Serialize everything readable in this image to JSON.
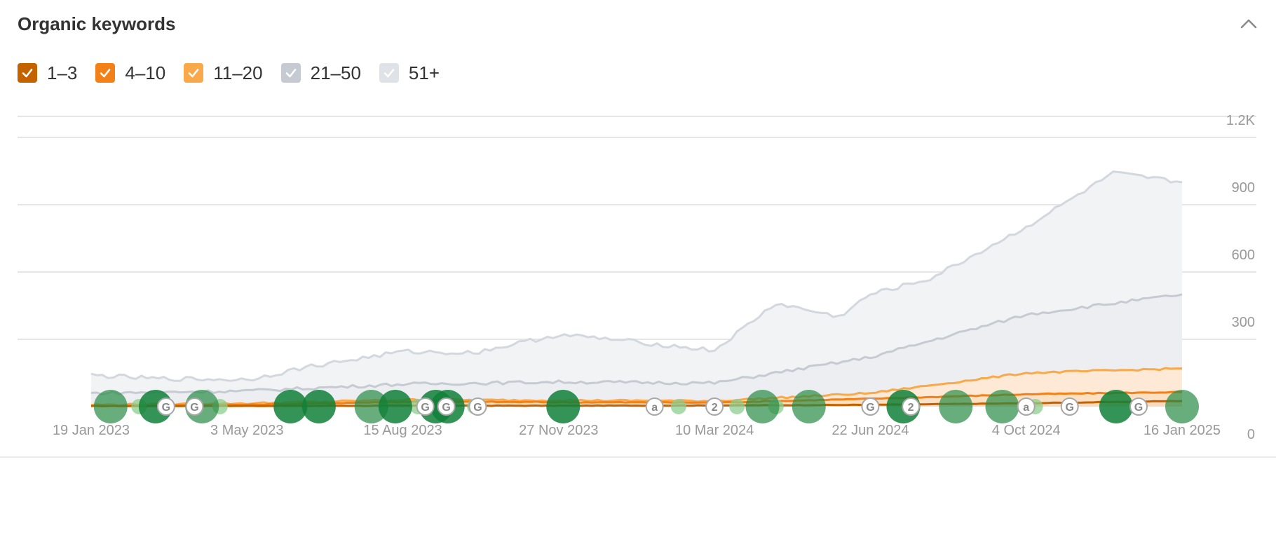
{
  "panel": {
    "title": "Organic keywords"
  },
  "legend": [
    {
      "label": "1–3",
      "color": "#c46200",
      "checked": true
    },
    {
      "label": "4–10",
      "color": "#f38118",
      "checked": true
    },
    {
      "label": "11–20",
      "color": "#f9a94a",
      "checked": true
    },
    {
      "label": "21–50",
      "color": "#c6cbd3",
      "checked": true
    },
    {
      "label": "51+",
      "color": "#dfe2e7",
      "checked": true
    }
  ],
  "chart_data": {
    "type": "area",
    "xlabel": "",
    "ylabel": "",
    "x_ticks": [
      "19 Jan 2023",
      "3 May 2023",
      "15 Aug 2023",
      "27 Nov 2023",
      "10 Mar 2024",
      "22 Jun 2024",
      "4 Oct 2024",
      "16 Jan 2025"
    ],
    "y_ticks": [
      "0",
      "300",
      "600",
      "900",
      "1.2K"
    ],
    "ylim": [
      0,
      1200
    ],
    "grid": true,
    "series": [
      {
        "name": "1–3",
        "color": "#c46200",
        "x": [
          "19 Jan 2023",
          "3 May 2023",
          "15 Aug 2023",
          "27 Nov 2023",
          "10 Mar 2024",
          "22 Jun 2024",
          "4 Oct 2024",
          "16 Jan 2025"
        ],
        "values": [
          2,
          3,
          4,
          4,
          5,
          8,
          15,
          25
        ]
      },
      {
        "name": "4–10",
        "color": "#f38118",
        "x": [
          "19 Jan 2023",
          "3 May 2023",
          "15 Aug 2023",
          "27 Nov 2023",
          "10 Mar 2024",
          "22 Jun 2024",
          "4 Oct 2024",
          "16 Jan 2025"
        ],
        "values": [
          4,
          8,
          22,
          20,
          18,
          35,
          55,
          65
        ]
      },
      {
        "name": "11–20",
        "color": "#f9a94a",
        "x": [
          "19 Jan 2023",
          "3 May 2023",
          "15 Aug 2023",
          "27 Nov 2023",
          "10 Mar 2024",
          "22 Jun 2024",
          "4 Oct 2024",
          "16 Jan 2025"
        ],
        "values": [
          8,
          14,
          30,
          28,
          25,
          60,
          150,
          170
        ]
      },
      {
        "name": "21–50",
        "color": "#c6cbd3",
        "x": [
          "19 Jan 2023",
          "3 May 2023",
          "15 Aug 2023",
          "27 Nov 2023",
          "10 Mar 2024",
          "22 Jun 2024",
          "4 Oct 2024",
          "16 Jan 2025"
        ],
        "values": [
          60,
          70,
          100,
          110,
          105,
          220,
          410,
          500
        ]
      },
      {
        "name": "51+",
        "color": "#dfe2e7",
        "x": [
          "19 Jan 2023",
          "1 Mar 2023",
          "3 May 2023",
          "15 Jun 2023",
          "15 Aug 2023",
          "1 Oct 2023",
          "27 Nov 2023",
          "1 Jan 2024",
          "10 Mar 2024",
          "20 Apr 2024",
          "1 Jun 2024",
          "22 Jun 2024",
          "1 Aug 2024",
          "4 Oct 2024",
          "1 Dec 2024",
          "16 Jan 2025"
        ],
        "values": [
          140,
          125,
          120,
          180,
          245,
          240,
          320,
          300,
          250,
          460,
          400,
          500,
          570,
          800,
          1040,
          1000
        ]
      }
    ],
    "annotations": [
      {
        "label": "G",
        "x": "10 Mar 2023"
      },
      {
        "label": "G",
        "x": "29 Mar 2023"
      },
      {
        "label": "G",
        "x": "30 Aug 2023"
      },
      {
        "label": "G",
        "x": "13 Sep 2023"
      },
      {
        "label": "G",
        "x": "4 Oct 2023"
      },
      {
        "label": "a",
        "x": "30 Jan 2024"
      },
      {
        "label": "2",
        "x": "10 Mar 2024"
      },
      {
        "label": "G",
        "x": "22 Jun 2024"
      },
      {
        "label": "2",
        "x": "19 Jul 2024"
      },
      {
        "label": "a",
        "x": "4 Oct 2024"
      },
      {
        "label": "G",
        "x": "2 Nov 2024"
      },
      {
        "label": "G",
        "x": "18 Dec 2024"
      }
    ],
    "events": [
      {
        "x": "1 Feb 2023",
        "size": "large",
        "shade": "medium"
      },
      {
        "x": "3 Mar 2023",
        "size": "large",
        "shade": "dark"
      },
      {
        "x": "3 Apr 2023",
        "size": "large",
        "shade": "medium"
      },
      {
        "x": "1 Jun 2023",
        "size": "large",
        "shade": "dark"
      },
      {
        "x": "20 Jun 2023",
        "size": "large",
        "shade": "dark"
      },
      {
        "x": "25 Jul 2023",
        "size": "large",
        "shade": "medium"
      },
      {
        "x": "10 Aug 2023",
        "size": "large",
        "shade": "dark"
      },
      {
        "x": "6 Sep 2023",
        "size": "large",
        "shade": "dark"
      },
      {
        "x": "14 Sep 2023",
        "size": "large",
        "shade": "dark"
      },
      {
        "x": "30 Nov 2023",
        "size": "large",
        "shade": "dark"
      },
      {
        "x": "11 Apr 2024",
        "size": "large",
        "shade": "medium"
      },
      {
        "x": "12 May 2024",
        "size": "large",
        "shade": "medium"
      },
      {
        "x": "14 Jul 2024",
        "size": "large",
        "shade": "dark"
      },
      {
        "x": "18 Aug 2024",
        "size": "large",
        "shade": "medium"
      },
      {
        "x": "18 Sep 2024",
        "size": "large",
        "shade": "medium"
      },
      {
        "x": "3 Dec 2024",
        "size": "large",
        "shade": "dark"
      },
      {
        "x": "16 Jan 2025",
        "size": "large",
        "shade": "medium"
      },
      {
        "x": "20 Feb 2023",
        "size": "small",
        "shade": "light"
      },
      {
        "x": "15 Apr 2023",
        "size": "small",
        "shade": "light"
      },
      {
        "x": "25 Aug 2023",
        "size": "small",
        "shade": "light"
      },
      {
        "x": "2 Oct 2023",
        "size": "small",
        "shade": "light"
      },
      {
        "x": "15 Feb 2024",
        "size": "small",
        "shade": "light"
      },
      {
        "x": "25 Mar 2024",
        "size": "small",
        "shade": "light"
      },
      {
        "x": "20 Apr 2024",
        "size": "small",
        "shade": "light"
      },
      {
        "x": "20 Jul 2024",
        "size": "small",
        "shade": "light"
      },
      {
        "x": "10 Oct 2024",
        "size": "small",
        "shade": "light"
      }
    ]
  }
}
